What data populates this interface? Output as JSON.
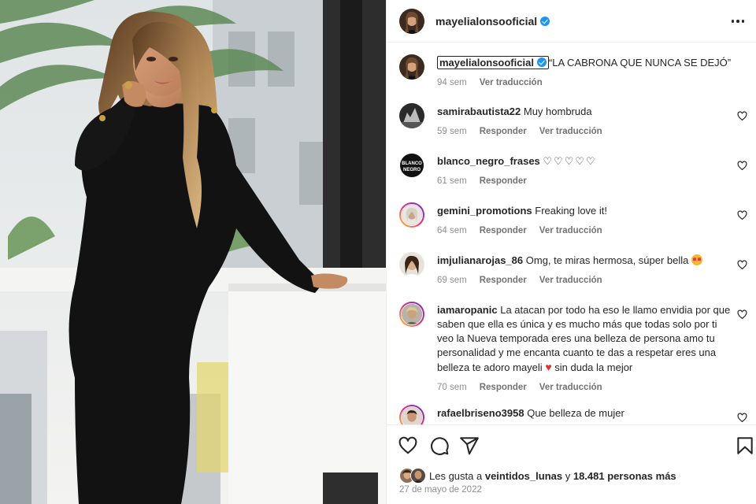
{
  "post": {
    "author": "mayelialonsooficial",
    "caption_text": "“LA CABRONA QUE NUNCA SE DEJÓ”",
    "caption_time": "94 sem",
    "caption_translate": "Ver traducción"
  },
  "labels": {
    "reply": "Responder",
    "translate": "Ver traducción"
  },
  "comments": [
    {
      "user": "samirabautista22",
      "text": "Muy hombruda",
      "time": "59 sem",
      "translate": true
    },
    {
      "user": "blanco_negro_frases",
      "text": "♡♡♡♡♡",
      "time": "61 sem",
      "translate": false
    },
    {
      "user": "gemini_promotions",
      "text": "Freaking love it!",
      "time": "64 sem",
      "translate": true
    },
    {
      "user": "imjulianarojas_86",
      "text": "Omg, te miras hermosa, súper bella",
      "time": "69 sem",
      "translate": true
    },
    {
      "user": "iamaropanic",
      "text_a": "La atacan por todo ha eso le llamo envidia por que saben que ella es única y es mucho más que todas solo por ti veo la Nueva temporada eres una belleza de persona amo tu personalidad y me encanta cuanto te das a respetar eres una belleza te adoro mayeli",
      "text_b": "sin duda la mejor",
      "time": "70 sem",
      "translate": true
    },
    {
      "user": "rafaelbriseno3958",
      "text": "Que belleza de mujer",
      "time": "",
      "translate": false
    }
  ],
  "emoji": {
    "red_heart": "♥",
    "avatar_text_1": "BLANCO",
    "avatar_text_2": "NEGRO"
  },
  "likes": {
    "prefix": "Les gusta a",
    "user": "veintidos_lunas",
    "conj": "y",
    "count": "18.481 personas más"
  },
  "date": "27 de mayo de 2022",
  "colors": {
    "verified": "#1e95f3",
    "text": "#262626",
    "muted": "#8e8e8e",
    "heart_red": "#ed2a3a"
  },
  "icons": [
    "more-icon",
    "heart-icon",
    "comment-icon",
    "share-icon",
    "bookmark-icon",
    "verified-icon"
  ]
}
